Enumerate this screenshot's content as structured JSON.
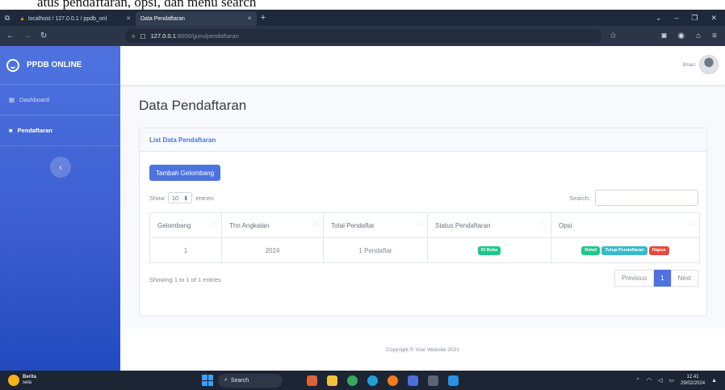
{
  "caption": "atus pendaftaran, opsi, dan menu search",
  "browser": {
    "tabs": [
      {
        "label": "localhost / 127.0.0.1 / ppdb_onl"
      },
      {
        "label": "Data Pendaftaran"
      }
    ],
    "url_host": "127.0.0.1",
    "url_path": ":8000/guru/pendaftaran"
  },
  "sidebar": {
    "brand": "PPDB ONLINE",
    "items": [
      {
        "label": "Dashboard"
      },
      {
        "label": "Pendaftaran"
      }
    ],
    "toggle_glyph": "‹"
  },
  "topbar": {
    "user_name": "ilman"
  },
  "page": {
    "title": "Data Pendaftaran"
  },
  "card": {
    "header": "List Data Pendaftaran",
    "add_button": "Tambah Gelombang",
    "show_label": "Show",
    "entries_value": "10",
    "entries_label": "entries",
    "search_label": "Search:",
    "columns": [
      "Gelombang",
      "Thn Angkatan",
      "Total Pendaftar",
      "Status Pendaftaran",
      "Opsi"
    ],
    "rows": [
      {
        "gelombang": "1",
        "tahun": "2024",
        "total": "1 Pendaftar",
        "status": "Di Buka",
        "opsi": [
          "Detail",
          "Tutup Pendaftaran",
          "Hapus"
        ]
      }
    ],
    "info": "Showing 1 to 1 of 1 entries",
    "pager": {
      "prev": "Previous",
      "current": "1",
      "next": "Next"
    }
  },
  "footer": "Copyright © Your Website 2021",
  "taskbar": {
    "weather_title": "Berita",
    "weather_sub": "sela",
    "search": "Search",
    "time": "12.41",
    "date": "29/02/2024"
  }
}
